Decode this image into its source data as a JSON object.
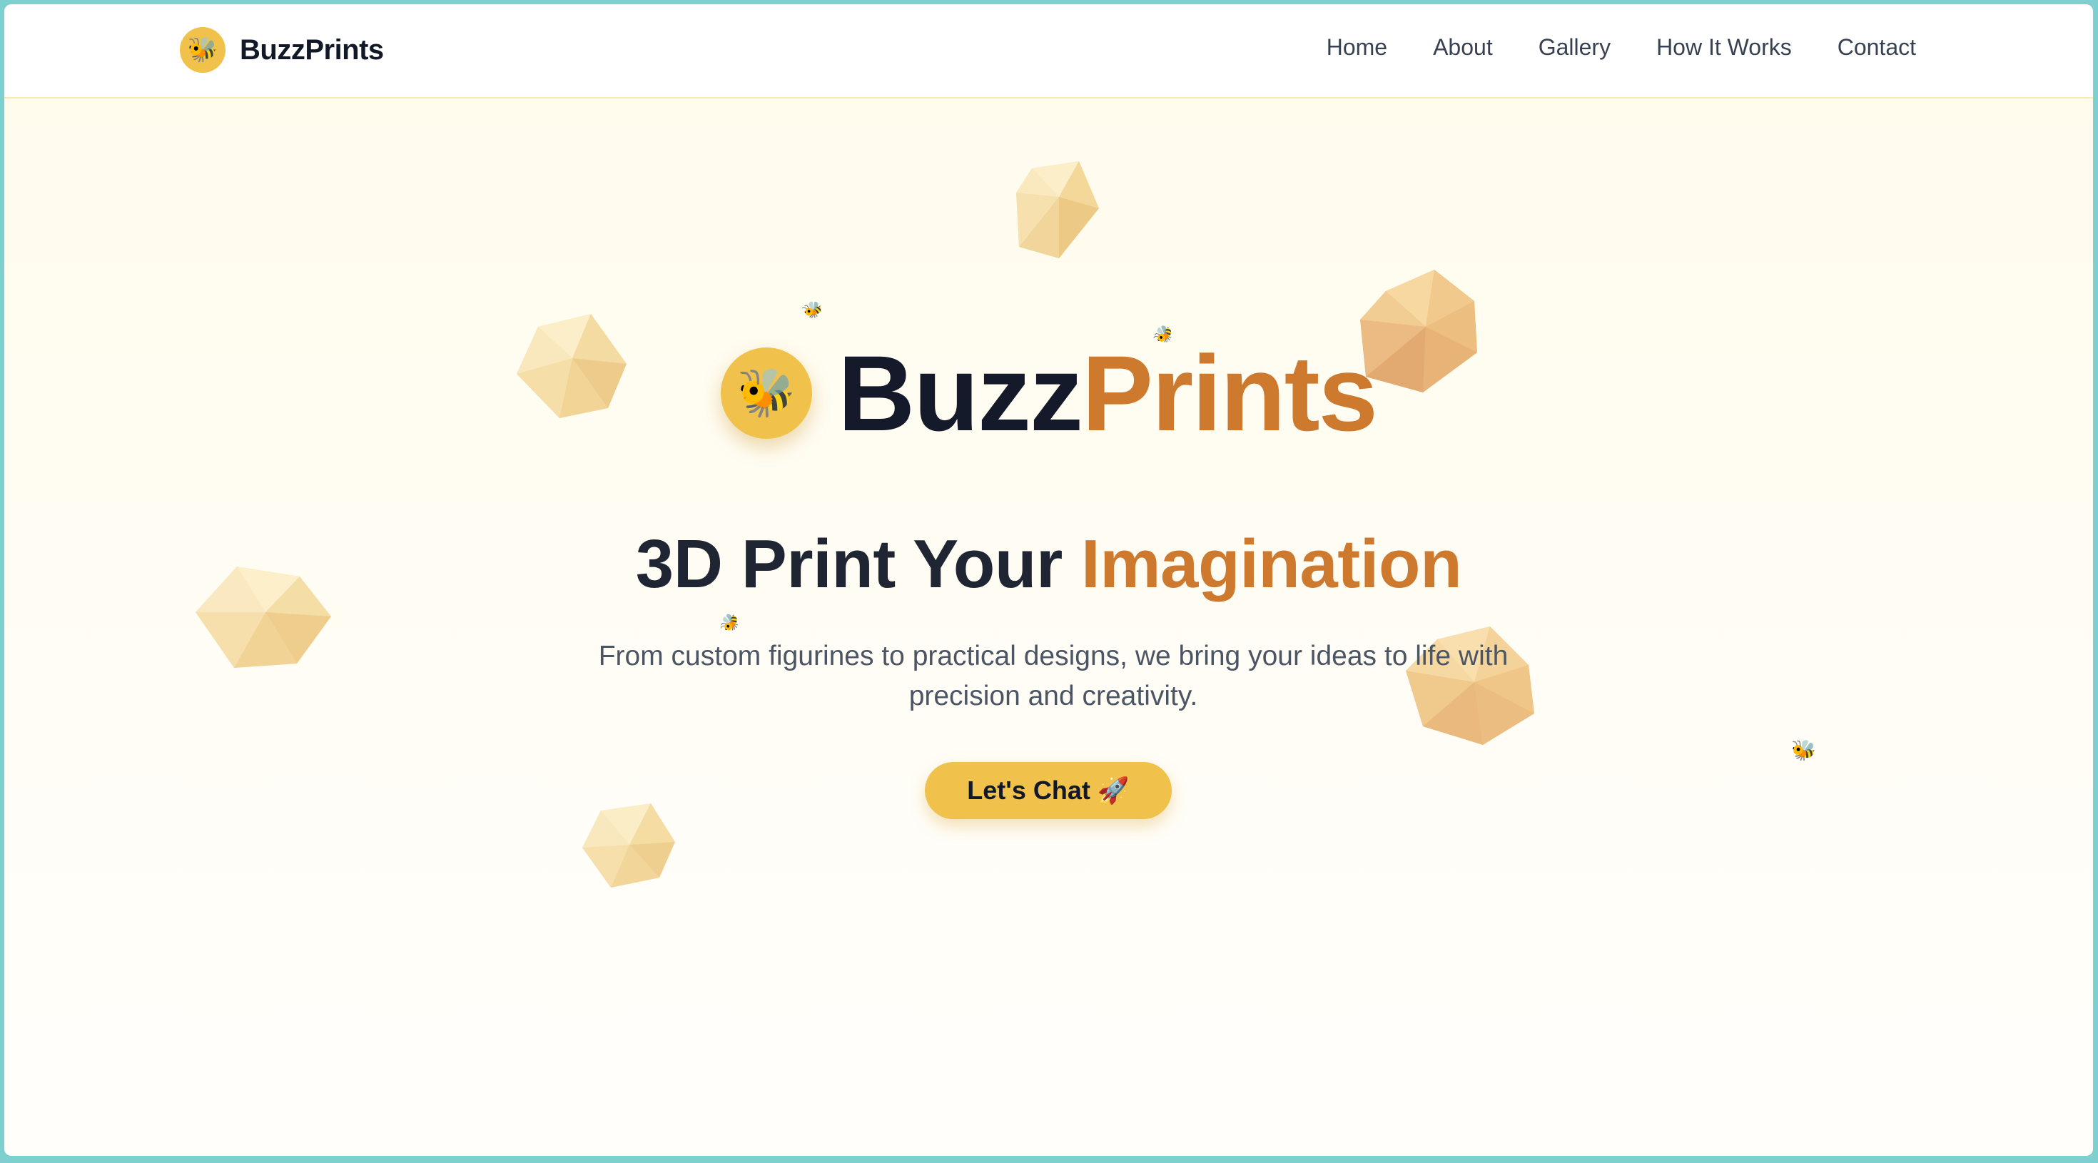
{
  "nav": {
    "brand": "BuzzPrints",
    "brand_icon": "bee-icon",
    "links": [
      "Home",
      "About",
      "Gallery",
      "How It Works",
      "Contact"
    ]
  },
  "hero": {
    "title_part1": "Buzz",
    "title_part2": "Prints",
    "title_icon": "bee-icon",
    "tagline_part1": "3D Print Your ",
    "tagline_part2": "Imagination",
    "subtitle": "From custom figurines to practical designs, we bring your ideas to life with precision and creativity.",
    "cta_label": "Let's Chat 🚀"
  },
  "colors": {
    "accent": "#cd7a2e",
    "brand_yellow": "#f0c14b",
    "dark_text": "#151a2b",
    "background": "#fffdf6"
  }
}
